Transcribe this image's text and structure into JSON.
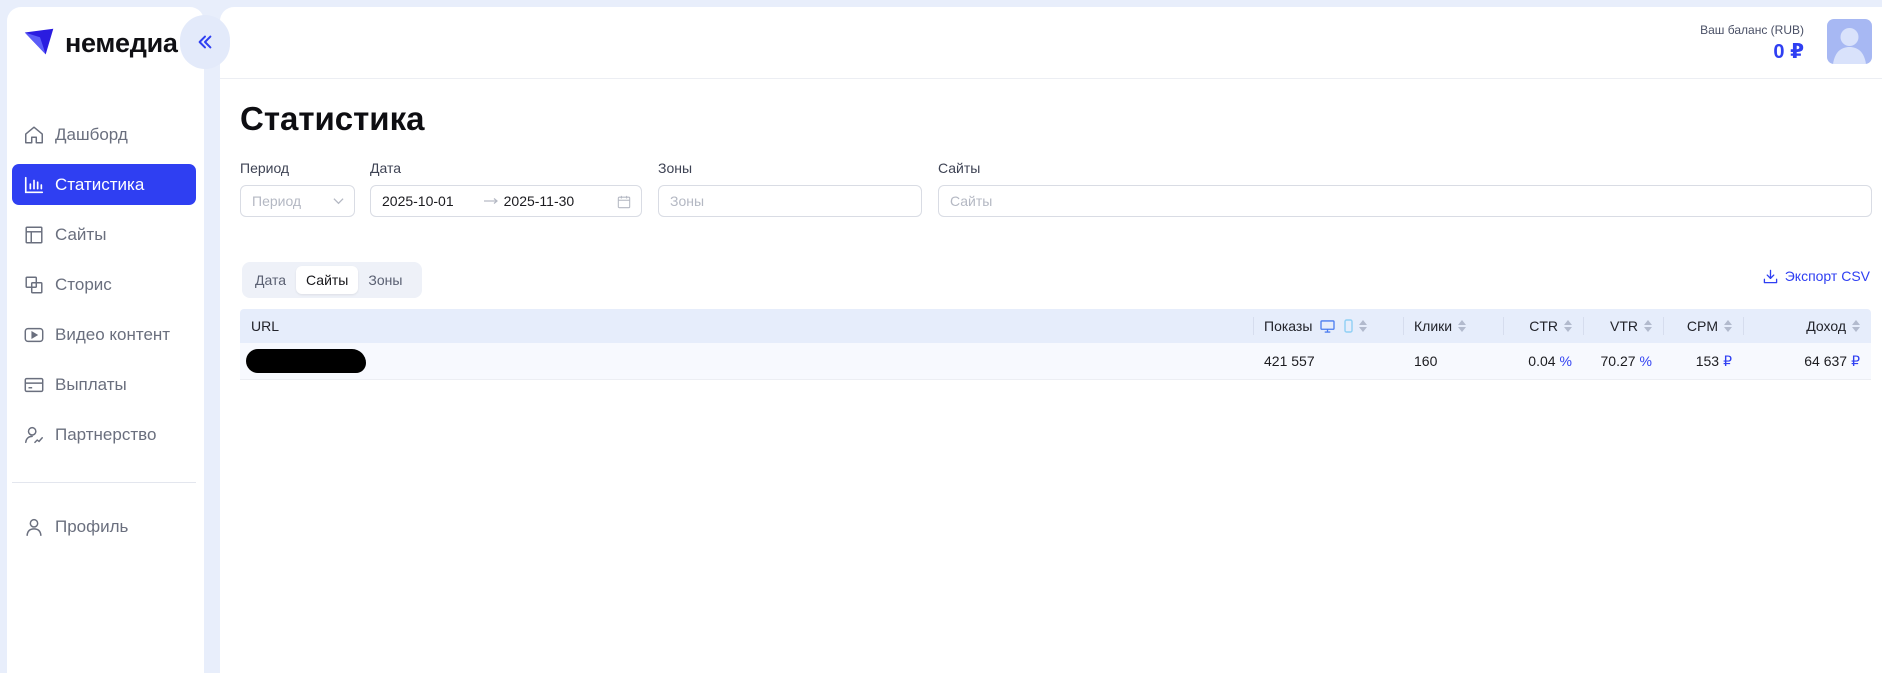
{
  "sidebar": {
    "logo_text": "немедиа",
    "items": [
      {
        "label": "Дашборд",
        "icon": "home-icon"
      },
      {
        "label": "Статистика",
        "icon": "bar-chart-icon"
      },
      {
        "label": "Сайты",
        "icon": "layout-icon"
      },
      {
        "label": "Сторис",
        "icon": "stories-icon"
      },
      {
        "label": "Видео контент",
        "icon": "video-icon"
      },
      {
        "label": "Выплаты",
        "icon": "wallet-icon"
      },
      {
        "label": "Партнерство",
        "icon": "partners-icon"
      }
    ],
    "profile_label": "Профиль",
    "active_index": 1
  },
  "header": {
    "balance_label": "Ваш баланс (RUB)",
    "balance_value": "0 ₽"
  },
  "page": {
    "title": "Статистика"
  },
  "filters": {
    "period": {
      "label": "Период",
      "placeholder": "Период"
    },
    "date": {
      "label": "Дата",
      "from": "2025-10-01",
      "to": "2025-11-30"
    },
    "zones": {
      "label": "Зоны",
      "placeholder": "Зоны"
    },
    "sites": {
      "label": "Сайты",
      "placeholder": "Сайты"
    }
  },
  "tabs": {
    "items": [
      "Дата",
      "Сайты",
      "Зоны"
    ],
    "active_index": 1
  },
  "export_label": "Экспорт CSV",
  "table": {
    "columns": [
      "URL",
      "Показы",
      "Клики",
      "CTR",
      "VTR",
      "CPM",
      "Доход"
    ],
    "rows": [
      {
        "url": "",
        "impressions": "421 557",
        "clicks": "160",
        "ctr": "0.04",
        "ctr_unit": "%",
        "vtr": "70.27",
        "vtr_unit": "%",
        "cpm": "153",
        "cpm_unit": "₽",
        "revenue": "64 637",
        "revenue_unit": "₽"
      }
    ]
  },
  "colors": {
    "accent": "#2f3ff2",
    "page_bg": "#e8eefb",
    "table_header_bg": "#e6edfb"
  }
}
